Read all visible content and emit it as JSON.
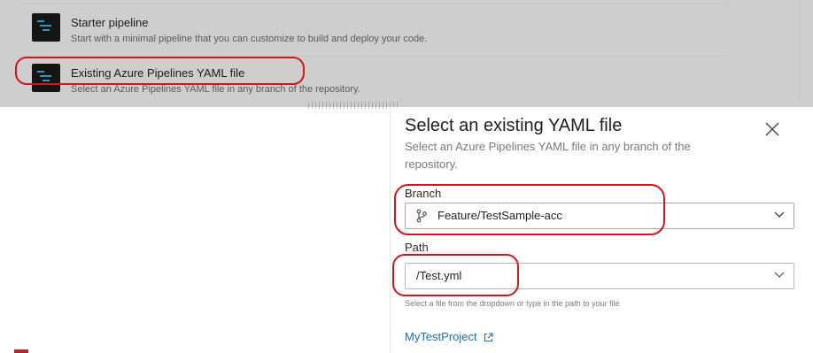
{
  "background": {
    "items": [
      {
        "title": "Starter pipeline",
        "desc": "Start with a minimal pipeline that you can customize to build and deploy your code.",
        "icon": "pipeline-icon"
      },
      {
        "title": "Existing Azure Pipelines YAML file",
        "desc": "Select an Azure Pipelines YAML file in any branch of the repository.",
        "icon": "pipeline-icon"
      }
    ]
  },
  "panel": {
    "title": "Select an existing YAML file",
    "subtitle": "Select an Azure Pipelines YAML file in any branch of the repository.",
    "close_icon": "close-icon",
    "branch": {
      "label": "Branch",
      "value": "Feature/TestSample-acc",
      "icon": "branch-icon"
    },
    "path": {
      "label": "Path",
      "value": "/Test.yml",
      "helper": "Select a file from the dropdown or type in the path to your file"
    },
    "project_link": "MyTestProject",
    "project_link_icon": "external-link-icon"
  },
  "colors": {
    "annotation": "#d4151f",
    "link": "#1f6fb5",
    "pipeline_icon_bg": "#151515",
    "pipeline_icon_accent": "#2e98c5"
  }
}
